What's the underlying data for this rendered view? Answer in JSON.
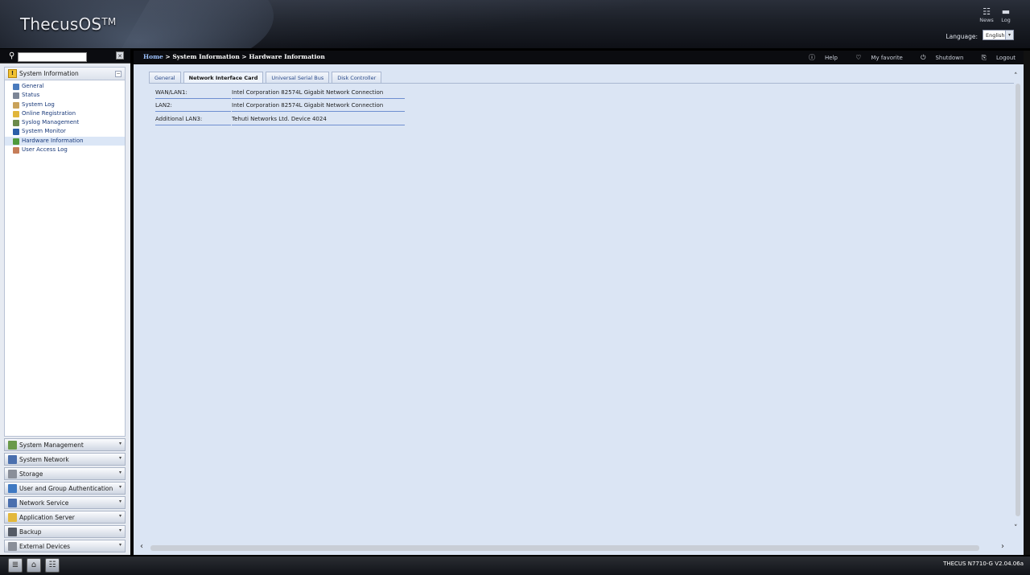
{
  "header": {
    "logo": "ThecusOS",
    "logo_tm": "TM",
    "news_label": "News",
    "log_label": "Log",
    "language_label": "Language:",
    "language_value": "English"
  },
  "sidebar": {
    "search_placeholder": "",
    "active_group": {
      "label": "System Information",
      "items": [
        {
          "label": "General",
          "color": "#4a7bbd"
        },
        {
          "label": "Status",
          "color": "#7c8596"
        },
        {
          "label": "System Log",
          "color": "#c9a25a"
        },
        {
          "label": "Online Registration",
          "color": "#e0b53a"
        },
        {
          "label": "Syslog Management",
          "color": "#6c8a4b"
        },
        {
          "label": "System Monitor",
          "color": "#2b5ea8"
        },
        {
          "label": "Hardware Information",
          "color": "#4f9a3c"
        },
        {
          "label": "User Access Log",
          "color": "#c67d58"
        }
      ],
      "selected_index": 6
    },
    "groups": [
      {
        "label": "System Management",
        "color": "#6a9a4a"
      },
      {
        "label": "System Network",
        "color": "#4a6fae"
      },
      {
        "label": "Storage",
        "color": "#8a8f99"
      },
      {
        "label": "User and Group Authentication",
        "color": "#3f79c2"
      },
      {
        "label": "Network Service",
        "color": "#4a6fae"
      },
      {
        "label": "Application Server",
        "color": "#e3b83c"
      },
      {
        "label": "Backup",
        "color": "#555b66"
      },
      {
        "label": "External Devices",
        "color": "#8a8f99"
      }
    ]
  },
  "breadcrumb": {
    "home": "Home",
    "sep1": " > ",
    "section": "System Information",
    "sep2": " > ",
    "page": "Hardware Information"
  },
  "toolbar": {
    "help": "Help",
    "favorite": "My favorite",
    "shutdown": "Shutdown",
    "logout": "Logout"
  },
  "tabs": [
    {
      "label": "General",
      "active": false
    },
    {
      "label": "Network Interface Card",
      "active": true
    },
    {
      "label": "Universal Serial Bus",
      "active": false
    },
    {
      "label": "Disk Controller",
      "active": false
    }
  ],
  "nic_rows": [
    {
      "key": "WAN/LAN1:",
      "value": "Intel Corporation 82574L Gigabit Network Connection"
    },
    {
      "key": "LAN2:",
      "value": "Intel Corporation 82574L Gigabit Network Connection"
    },
    {
      "key": "Additional LAN3:",
      "value": "Tehuti Networks Ltd. Device 4024"
    }
  ],
  "footer": {
    "version": "THECUS N7710-G V2.04.06a"
  }
}
